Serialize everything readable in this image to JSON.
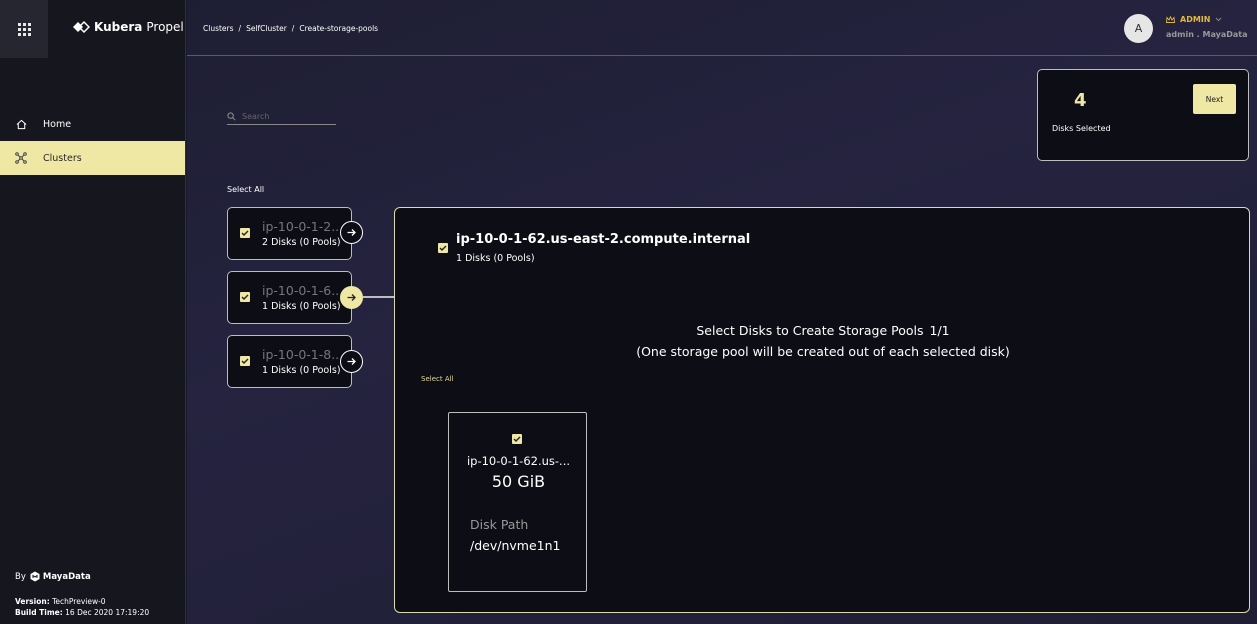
{
  "brand": {
    "name": "Kubera",
    "sub": "Propel"
  },
  "sidebar": {
    "items": [
      {
        "label": "Home",
        "icon": "home-icon"
      },
      {
        "label": "Clusters",
        "icon": "clusters-icon",
        "active": true
      }
    ],
    "by_label": "By",
    "by_company": "MayaData",
    "version_label": "Version:",
    "version_value": "TechPreview-0",
    "build_label": "Build Time:",
    "build_value": "16 Dec 2020 17:19:20"
  },
  "breadcrumb": [
    "Clusters",
    "/",
    "SelfCluster",
    "/",
    "Create-storage-pools"
  ],
  "user": {
    "initial": "A",
    "role": "ADMIN",
    "name": "admin . MayaData"
  },
  "search": {
    "placeholder": "Search",
    "value": ""
  },
  "select_all_label": "Select All",
  "summary": {
    "count": "4",
    "label": "Disks Selected",
    "next_label": "Next"
  },
  "nodes": [
    {
      "name": "ip-10-0-1-2...",
      "sub": "2 Disks (0 Pools)",
      "checked": true
    },
    {
      "name": "ip-10-0-1-6...",
      "sub": "1 Disks (0 Pools)",
      "checked": true,
      "active": true
    },
    {
      "name": "ip-10-0-1-8...",
      "sub": "1 Disks (0 Pools)",
      "checked": true
    }
  ],
  "detail": {
    "title": "ip-10-0-1-62.us-east-2.compute.internal",
    "sub": "1 Disks (0 Pools)",
    "heading": "Select Disks to Create Storage Pools",
    "heading_count": "1/1",
    "heading_note": "(One storage pool will be created out of each selected disk)",
    "select_all_label": "Select All",
    "disks": [
      {
        "name": "ip-10-0-1-62.us-...",
        "size": "50 GiB",
        "path_label": "Disk Path",
        "path": "/dev/nvme1n1",
        "checked": true
      }
    ]
  },
  "colors": {
    "accent": "#efe7a4",
    "role": "#e2b93b",
    "panel": "#0d0d15"
  }
}
